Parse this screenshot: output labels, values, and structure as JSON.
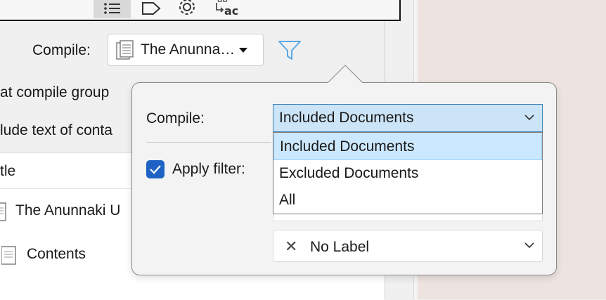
{
  "toolbar": {
    "buttons": [
      {
        "name": "list-icon",
        "active": true
      },
      {
        "name": "tag-icon",
        "active": false
      },
      {
        "name": "gear-icon",
        "active": false
      },
      {
        "name": "replace-text-icon",
        "active": false
      }
    ],
    "replace_icon_top": "ab",
    "replace_icon_bottom": "ac"
  },
  "compile_row": {
    "label": "Compile:",
    "selected_document": "The Anunna…"
  },
  "background_options": {
    "option1": "at compile group",
    "option2": "lude text of conta"
  },
  "outline": {
    "header": "tle",
    "rows": [
      {
        "title": "The Anunnaki U",
        "icon": "document-icon"
      },
      {
        "title": "Contents",
        "icon": "document-icon"
      }
    ]
  },
  "popover": {
    "compile_label": "Compile:",
    "compile_value": "Included Documents",
    "dropdown_options": [
      "Included Documents",
      "Excluded Documents",
      "All"
    ],
    "selected_option": "Included Documents",
    "apply_filter_label": "Apply filter:",
    "apply_filter_checked": true,
    "label_value": "No Label"
  },
  "colors": {
    "accent": "#1e63c4",
    "selected_bg": "#cce8ff",
    "filter_icon": "#5aa9e6",
    "right_bg": "#ede3e1"
  }
}
